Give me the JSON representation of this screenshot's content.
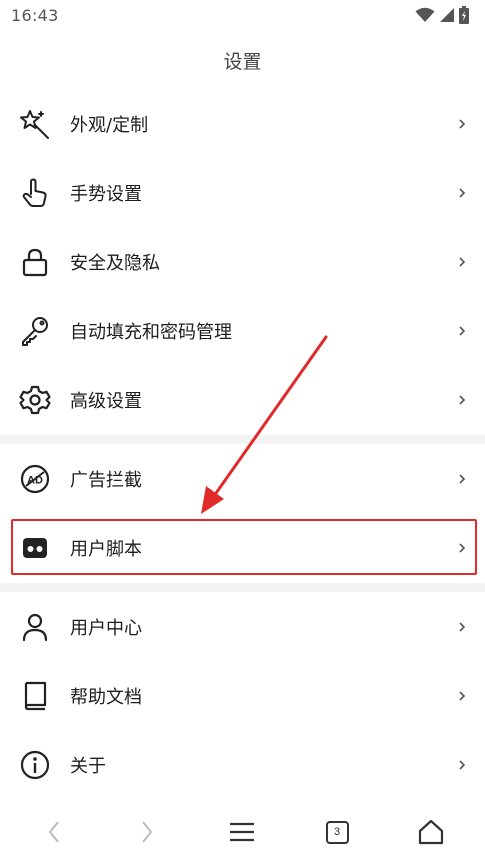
{
  "status_bar": {
    "time": "16:43"
  },
  "title": "设置",
  "groups": [
    {
      "items": [
        {
          "label": "外观/定制",
          "icon": "magic-wand-icon"
        },
        {
          "label": "手势设置",
          "icon": "hand-pointer-icon"
        },
        {
          "label": "安全及隐私",
          "icon": "lock-icon"
        },
        {
          "label": "自动填充和密码管理",
          "icon": "key-icon"
        },
        {
          "label": "高级设置",
          "icon": "gear-icon"
        }
      ]
    },
    {
      "items": [
        {
          "label": "广告拦截",
          "icon": "ad-block-icon"
        },
        {
          "label": "用户脚本",
          "icon": "user-script-icon",
          "highlighted": true
        }
      ]
    },
    {
      "items": [
        {
          "label": "用户中心",
          "icon": "person-icon"
        },
        {
          "label": "帮助文档",
          "icon": "book-icon"
        },
        {
          "label": "关于",
          "icon": "info-icon"
        }
      ]
    }
  ],
  "bottom_bar": {
    "tab_count": "3",
    "buttons": [
      "back-icon",
      "forward-icon",
      "menu-icon",
      "tabs-icon",
      "home-icon"
    ]
  },
  "colors": {
    "highlight": "#e02a2a",
    "separator": "#f3f3f3"
  }
}
